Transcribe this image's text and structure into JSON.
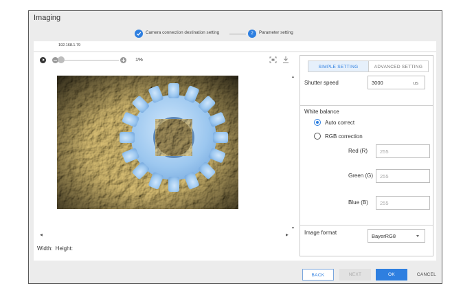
{
  "window": {
    "title": "Imaging"
  },
  "stepper": {
    "step1_label": "Camera connection destination setting",
    "step2_number": "2",
    "step2_label": "Parameter setting",
    "accent": "#2e7fe0"
  },
  "camera": {
    "ip": "192.168.1.79"
  },
  "viewer": {
    "zoom_percent": "1%",
    "zoom_slider_level": 0.01,
    "width_label": "Width:",
    "height_label": "Height:",
    "icons": [
      "play-icon",
      "zoom-out-icon",
      "zoom-in-icon",
      "fit-screen-icon",
      "download-icon"
    ]
  },
  "tabs": {
    "simple": "SIMPLE SETTING",
    "advanced": "ADVANCED SETTING"
  },
  "settings": {
    "shutter_label": "Shutter speed",
    "shutter_value": "3000",
    "shutter_unit": "us",
    "white_balance_label": "White balance",
    "auto_correct_label": "Auto correct",
    "rgb_correction_label": "RGB correction",
    "white_balance_mode": "Auto correct",
    "red_label": "Red (R)",
    "red_value": "255",
    "green_label": "Green (G)",
    "green_value": "255",
    "blue_label": "Blue (B)",
    "blue_value": "255",
    "image_format_label": "Image format",
    "image_format_value": "BayerRG8"
  },
  "footer": {
    "back": "BACK",
    "next": "NEXT",
    "ok": "OK",
    "cancel": "CANCEL"
  }
}
